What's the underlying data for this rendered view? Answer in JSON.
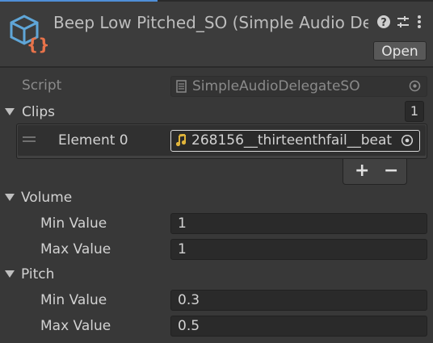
{
  "header": {
    "title": "Beep Low Pitched_SO (Simple Audio Delegate",
    "open_label": "Open",
    "icons": [
      "scriptable-object-icon",
      "help-icon",
      "preset-sliders-icon",
      "kebab-menu-icon"
    ]
  },
  "script_row": {
    "label": "Script",
    "value": "SimpleAudioDelegateSO"
  },
  "clips": {
    "label": "Clips",
    "count": "1",
    "elements": [
      {
        "label": "Element 0",
        "value": "268156__thirteenthfail__beat"
      }
    ],
    "add_label": "+",
    "remove_label": "−"
  },
  "volume": {
    "label": "Volume",
    "min_label": "Min Value",
    "min_value": "1",
    "max_label": "Max Value",
    "max_value": "1"
  },
  "pitch": {
    "label": "Pitch",
    "min_label": "Min Value",
    "min_value": "0.3",
    "max_label": "Max Value",
    "max_value": "0.5"
  },
  "colors": {
    "accent": "#4f8fd8",
    "logo_blue": "#5fa6d8",
    "logo_orange": "#e8734a",
    "audio_icon": "#e0b43a"
  }
}
